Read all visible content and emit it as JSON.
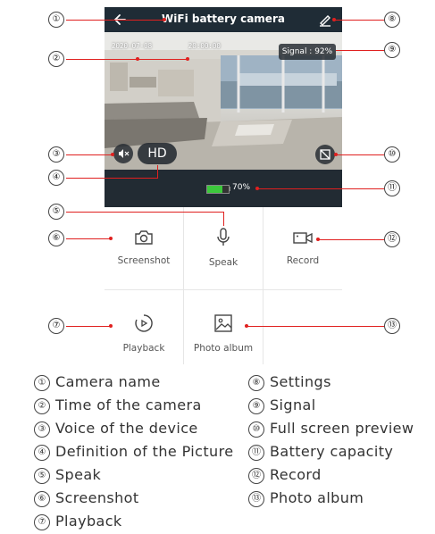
{
  "header": {
    "title": "WiFi battery camera"
  },
  "video": {
    "timestamp_date": "2020-07-08",
    "timestamp_time": "20:00:00",
    "signal_label": "Signal : 92%",
    "definition_label": "HD"
  },
  "status_bar": {
    "battery_text": "70%",
    "battery_level_percent": 70
  },
  "controls": {
    "screenshot": "Screenshot",
    "speak": "Speak",
    "record": "Record",
    "playback": "Playback",
    "photo_album": "Photo album"
  },
  "callouts": [
    "①",
    "②",
    "③",
    "④",
    "⑤",
    "⑥",
    "⑦",
    "⑧",
    "⑨",
    "⑩",
    "⑪",
    "⑫",
    "⑬"
  ],
  "legend_left": [
    {
      "num": "①",
      "text": "Camera name"
    },
    {
      "num": "②",
      "text": "Time of the camera"
    },
    {
      "num": "③",
      "text": "Voice of the device"
    },
    {
      "num": "④",
      "text": "Definition of the Picture"
    },
    {
      "num": "⑤",
      "text": "Speak"
    },
    {
      "num": "⑥",
      "text": "Screenshot"
    },
    {
      "num": "⑦",
      "text": "Playback"
    }
  ],
  "legend_right": [
    {
      "num": "⑧",
      "text": "Settings"
    },
    {
      "num": "⑨",
      "text": "Signal"
    },
    {
      "num": "⑩",
      "text": "Full screen preview"
    },
    {
      "num": "⑪",
      "text": "Battery capacity"
    },
    {
      "num": "⑫",
      "text": "Record"
    },
    {
      "num": "⑬",
      "text": "Photo album"
    }
  ],
  "colors": {
    "header_bg": "#1f2c36",
    "callout_line": "#e0201f",
    "battery_green": "#3cc83c"
  }
}
